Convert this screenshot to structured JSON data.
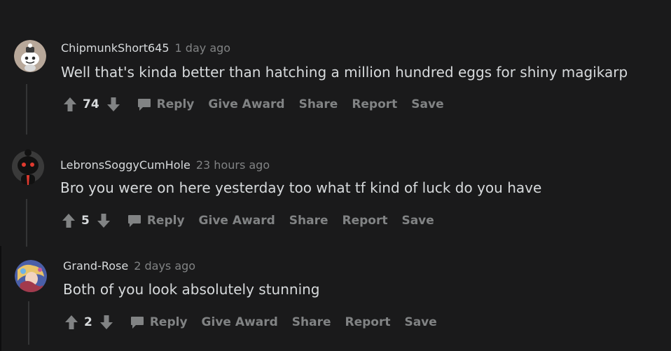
{
  "comments": [
    {
      "username": "ChipmunkShort645",
      "time": "1 day ago",
      "body": "Well that's kinda better than hatching a million hundred eggs for shiny magikarp",
      "score": "74",
      "avatar": "snoo-avatar-icon"
    },
    {
      "username": "LebronsSoggyCumHole",
      "time": "23 hours ago",
      "body": "Bro you were on here yesterday too what tf kind of luck do you have",
      "score": "5",
      "avatar": "dark-snoo-avatar-icon"
    },
    {
      "username": "Grand-Rose",
      "time": "2 days ago",
      "body": "Both of you look absolutely stunning",
      "score": "2",
      "avatar": "anime-avatar-icon"
    }
  ],
  "actions": {
    "reply": "Reply",
    "give_award": "Give Award",
    "share": "Share",
    "report": "Report",
    "save": "Save"
  },
  "colors": {
    "background": "#1a1a1b",
    "text": "#d7dadc",
    "muted": "#818384",
    "thread_line": "#343536"
  }
}
